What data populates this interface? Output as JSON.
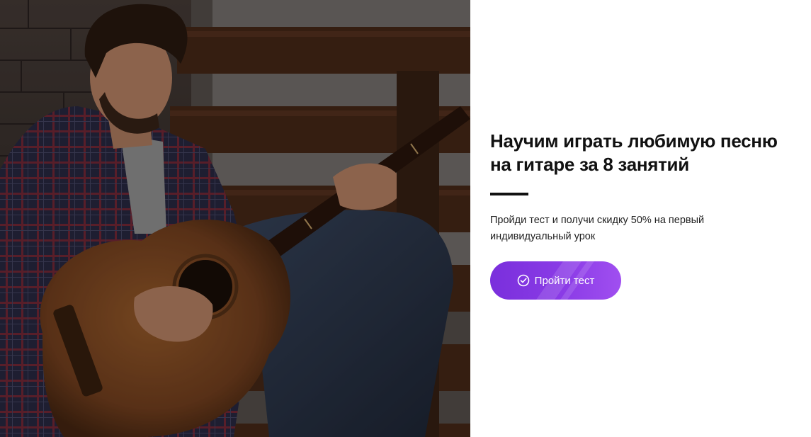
{
  "hero": {
    "image_icon": "guitarist-photo"
  },
  "content": {
    "title_line1": "Научим играть любимую песню",
    "title_line2": "на гитаре за 8 занятий",
    "subtitle_line1": "Пройди тест и получи скидку 50% на первый",
    "subtitle_line2": "индивидуальный урок",
    "cta": {
      "label": "Пройти тест",
      "icon": "check-circle-icon"
    }
  },
  "colors": {
    "accent": "#8a3be6",
    "text": "#111111",
    "background": "#ffffff"
  }
}
